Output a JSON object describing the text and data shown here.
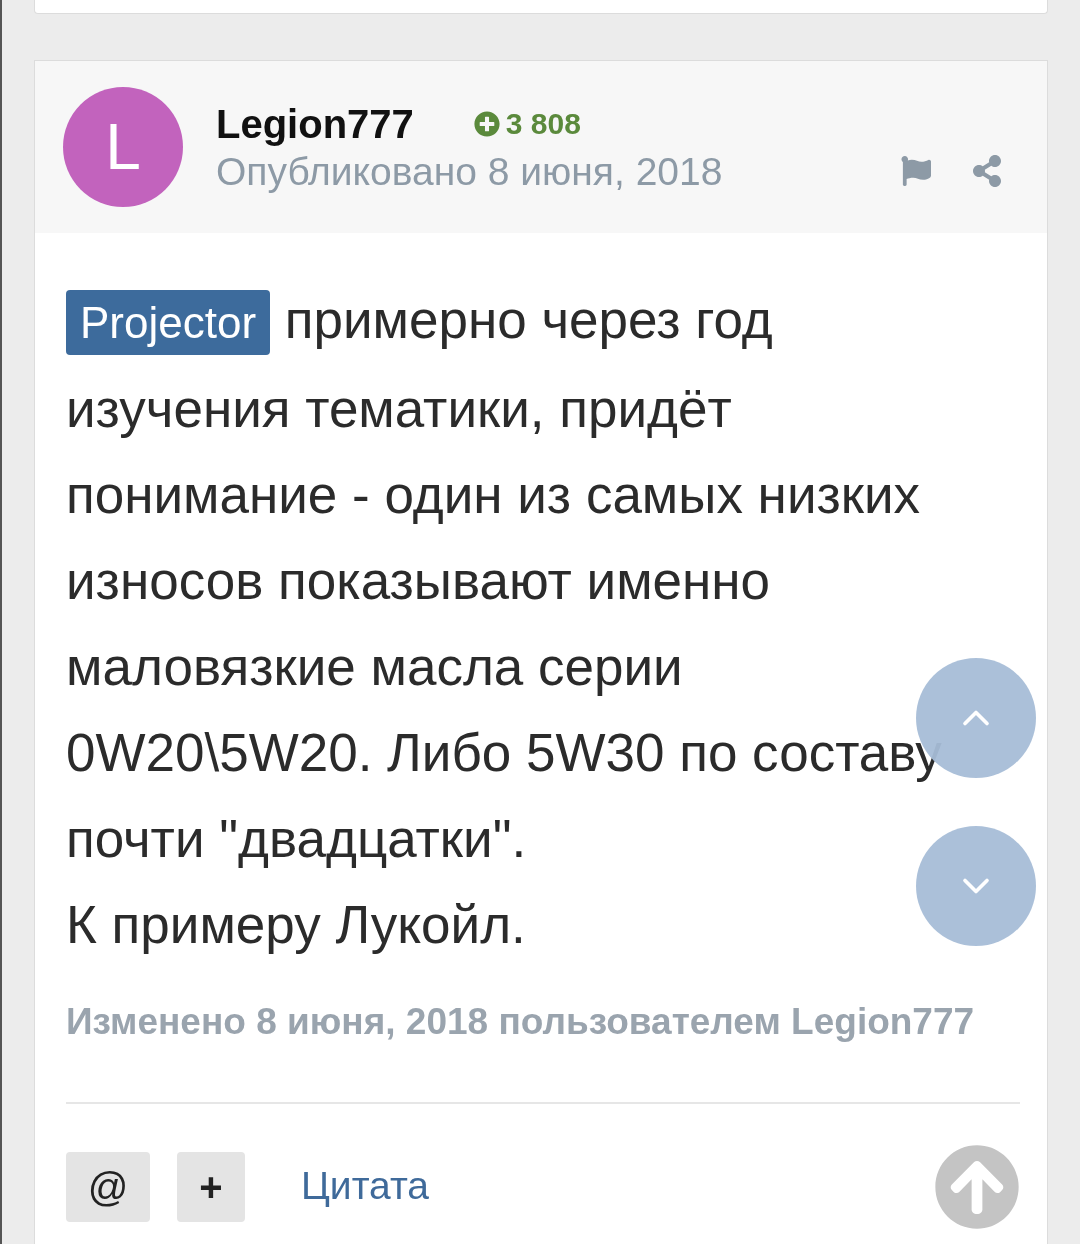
{
  "post": {
    "avatar_letter": "L",
    "author": "Legion777",
    "reputation": "3 808",
    "published": "Опубликовано 8 июня, 2018",
    "mention": "Projector",
    "body": "примерно через год изучения тематики, придёт понимание - один из самых низких износов показывают именно маловязкие масла серии 0W20\\5W20. Либо 5W30 по составу почти \"двадцатки\".",
    "body_2": "К примеру Лукойл.",
    "edited": "Изменено 8 июня, 2018 пользователем Legion777",
    "actions": {
      "mention_button": "@",
      "add_button": "+",
      "quote_link": "Цитата"
    }
  }
}
